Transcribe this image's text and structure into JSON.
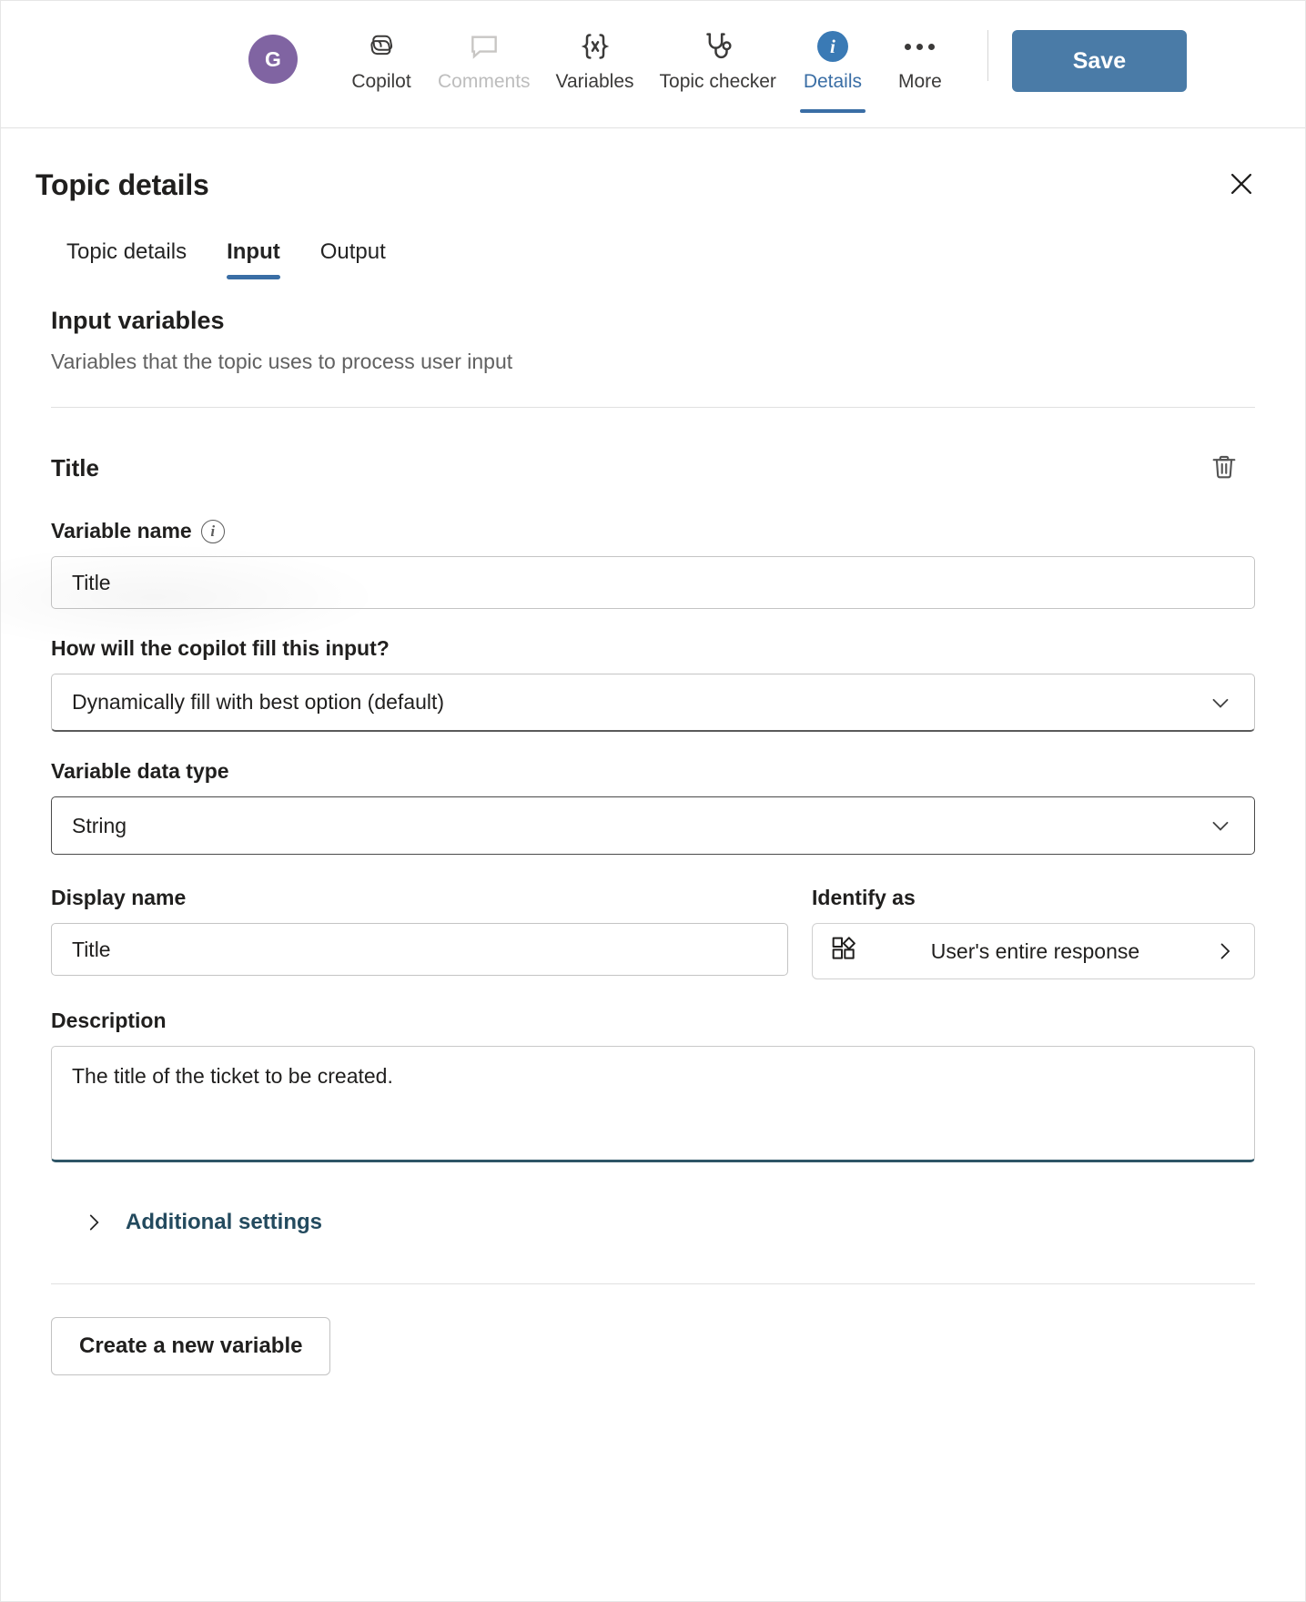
{
  "topbar": {
    "avatar_initial": "G",
    "commands": [
      {
        "label": "Copilot",
        "icon": "copilot-icon",
        "state": "normal"
      },
      {
        "label": "Comments",
        "icon": "comment-icon",
        "state": "disabled"
      },
      {
        "label": "Variables",
        "icon": "variables-braces-icon",
        "state": "normal"
      },
      {
        "label": "Topic checker",
        "icon": "stethoscope-icon",
        "state": "normal"
      },
      {
        "label": "Details",
        "icon": "info-circle-icon",
        "state": "active"
      },
      {
        "label": "More",
        "icon": "ellipsis-icon",
        "state": "normal"
      }
    ],
    "save_label": "Save",
    "accent_blue": "#3a6ea5",
    "save_bg": "#4a7ba7",
    "avatar_bg": "#8064A2"
  },
  "panel": {
    "title": "Topic details",
    "close_icon": "close-icon",
    "tabs": [
      {
        "label": "Topic details",
        "selected": false
      },
      {
        "label": "Input",
        "selected": true
      },
      {
        "label": "Output",
        "selected": false
      }
    ]
  },
  "input_section": {
    "heading": "Input variables",
    "subtitle": "Variables that the topic uses to process user input"
  },
  "variable": {
    "heading": "Title",
    "delete_icon": "trash-icon",
    "variable_name": {
      "label": "Variable name",
      "info_icon": "info-icon",
      "value": "Title",
      "placeholder": "Variable name"
    },
    "fill_mode": {
      "label": "How will the copilot fill this input?",
      "value": "Dynamically fill with best option (default)",
      "chevron": "chevron-down-icon"
    },
    "data_type": {
      "label": "Variable data type",
      "value": "String",
      "chevron": "chevron-down-icon"
    },
    "display_name": {
      "label": "Display name",
      "value": "Title",
      "placeholder": "Display name"
    },
    "identify_as": {
      "label": "Identify as",
      "value": "User's entire response",
      "icon": "entity-blocks-icon",
      "chevron": "chevron-right-icon"
    },
    "description": {
      "label": "Description",
      "value": "The title of the ticket to be created.",
      "placeholder": "Description",
      "focused": true,
      "focus_color": "#2e5566"
    },
    "additional_settings": {
      "label": "Additional settings",
      "caret": "chevron-right-icon",
      "expanded": false,
      "link_color": "#234a5e"
    }
  },
  "footer": {
    "create_variable_label": "Create a new variable"
  }
}
